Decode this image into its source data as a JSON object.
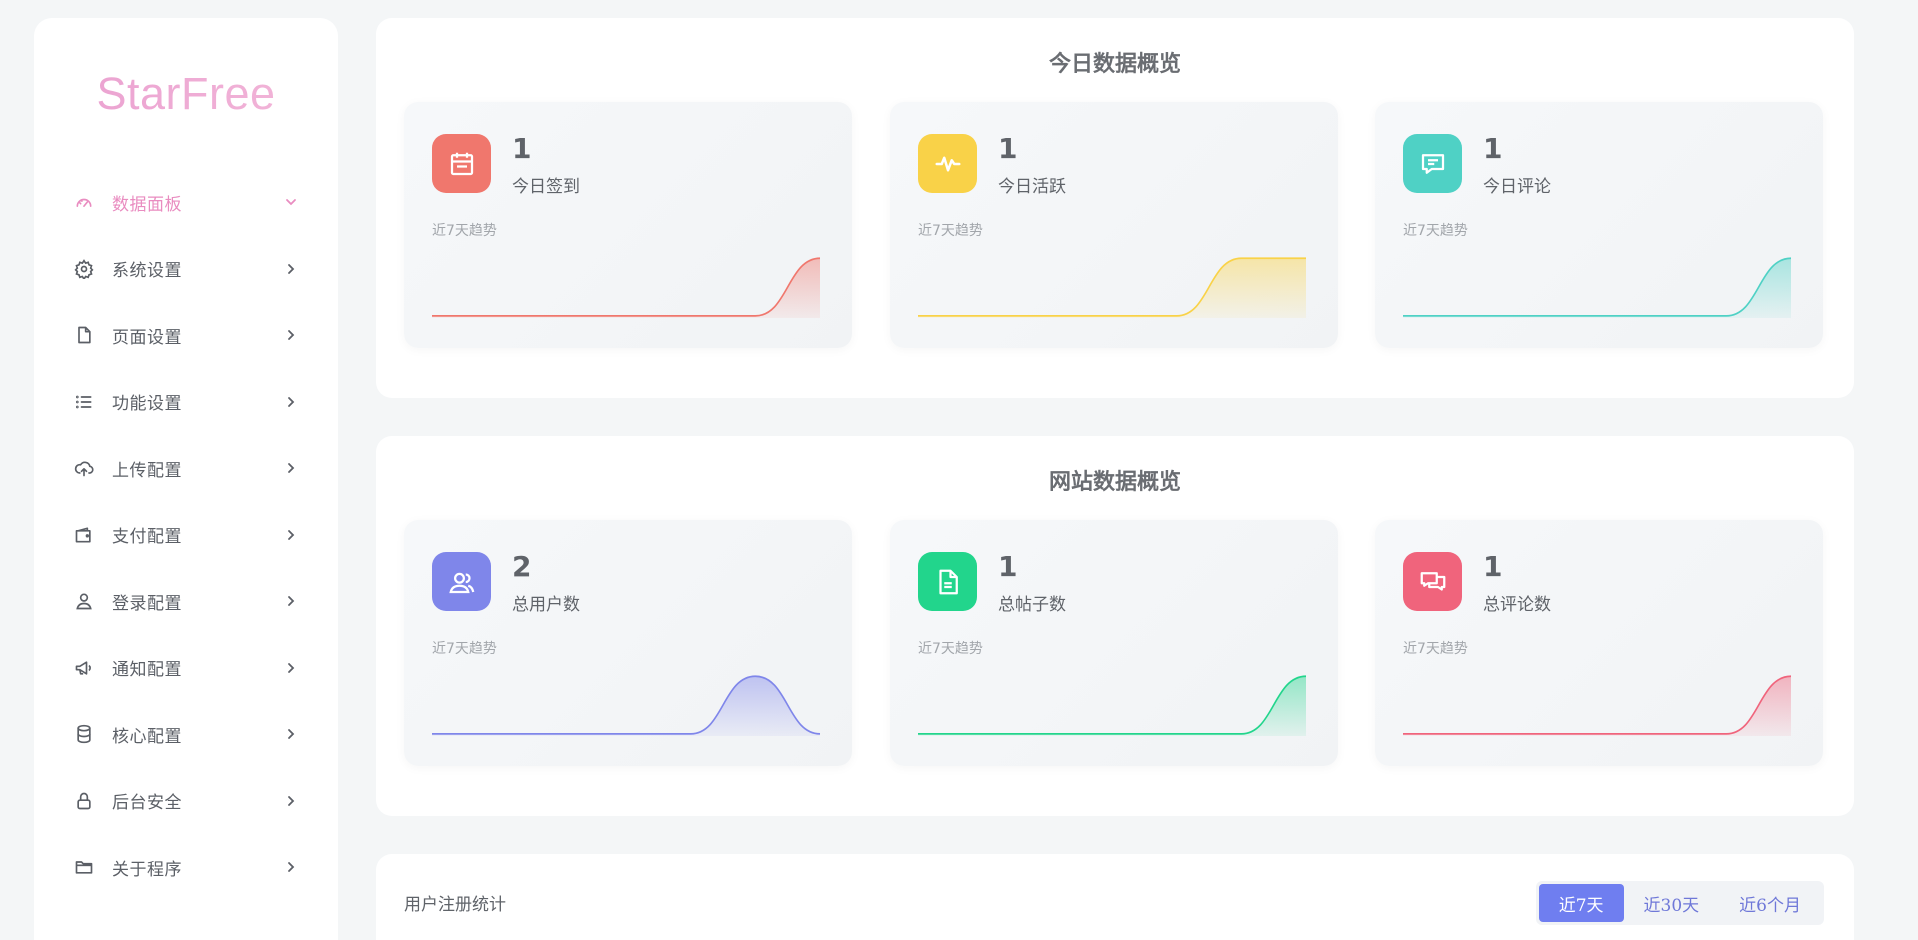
{
  "brand": {
    "logo": "StarFree"
  },
  "sidebar": {
    "items": [
      {
        "label": "数据面板",
        "icon": "dashboard-gauge-icon",
        "active": true
      },
      {
        "label": "系统设置",
        "icon": "gear-icon"
      },
      {
        "label": "页面设置",
        "icon": "document-icon"
      },
      {
        "label": "功能设置",
        "icon": "list-icon"
      },
      {
        "label": "上传配置",
        "icon": "cloud-upload-icon"
      },
      {
        "label": "支付配置",
        "icon": "wallet-icon"
      },
      {
        "label": "登录配置",
        "icon": "user-icon"
      },
      {
        "label": "通知配置",
        "icon": "megaphone-icon"
      },
      {
        "label": "核心配置",
        "icon": "database-icon"
      },
      {
        "label": "后台安全",
        "icon": "lock-icon"
      },
      {
        "label": "关于程序",
        "icon": "folder-icon"
      }
    ]
  },
  "today": {
    "title": "今日数据概览",
    "cards": [
      {
        "value": "1",
        "label": "今日签到",
        "trend": "近7天趋势",
        "icon": "calendar-icon",
        "color": "#f0776d",
        "spark": [
          0,
          0,
          0,
          0,
          0,
          0,
          1
        ]
      },
      {
        "value": "1",
        "label": "今日活跃",
        "trend": "近7天趋势",
        "icon": "activity-pulse-icon",
        "color": "#f9d248",
        "spark": [
          0,
          0,
          0,
          0,
          0,
          1,
          1
        ]
      },
      {
        "value": "1",
        "label": "今日评论",
        "trend": "近7天趋势",
        "icon": "comment-icon",
        "color": "#4fd1c5",
        "spark": [
          0,
          0,
          0,
          0,
          0,
          0,
          1
        ]
      }
    ]
  },
  "site": {
    "title": "网站数据概览",
    "cards": [
      {
        "value": "2",
        "label": "总用户数",
        "trend": "近7天趋势",
        "icon": "users-icon",
        "color": "#7f86ea",
        "spark": [
          0,
          0,
          0,
          0,
          0,
          1,
          0
        ]
      },
      {
        "value": "1",
        "label": "总帖子数",
        "trend": "近7天趋势",
        "icon": "post-document-icon",
        "color": "#22d58c",
        "spark": [
          0,
          0,
          0,
          0,
          0,
          0,
          1
        ]
      },
      {
        "value": "1",
        "label": "总评论数",
        "trend": "近7天趋势",
        "icon": "comments-icon",
        "color": "#f0647c",
        "spark": [
          0,
          0,
          0,
          0,
          0,
          0,
          1
        ]
      }
    ]
  },
  "registration": {
    "title": "用户注册统计",
    "ranges": [
      "近7天",
      "近30天",
      "近6个月"
    ],
    "selected": "近7天"
  }
}
